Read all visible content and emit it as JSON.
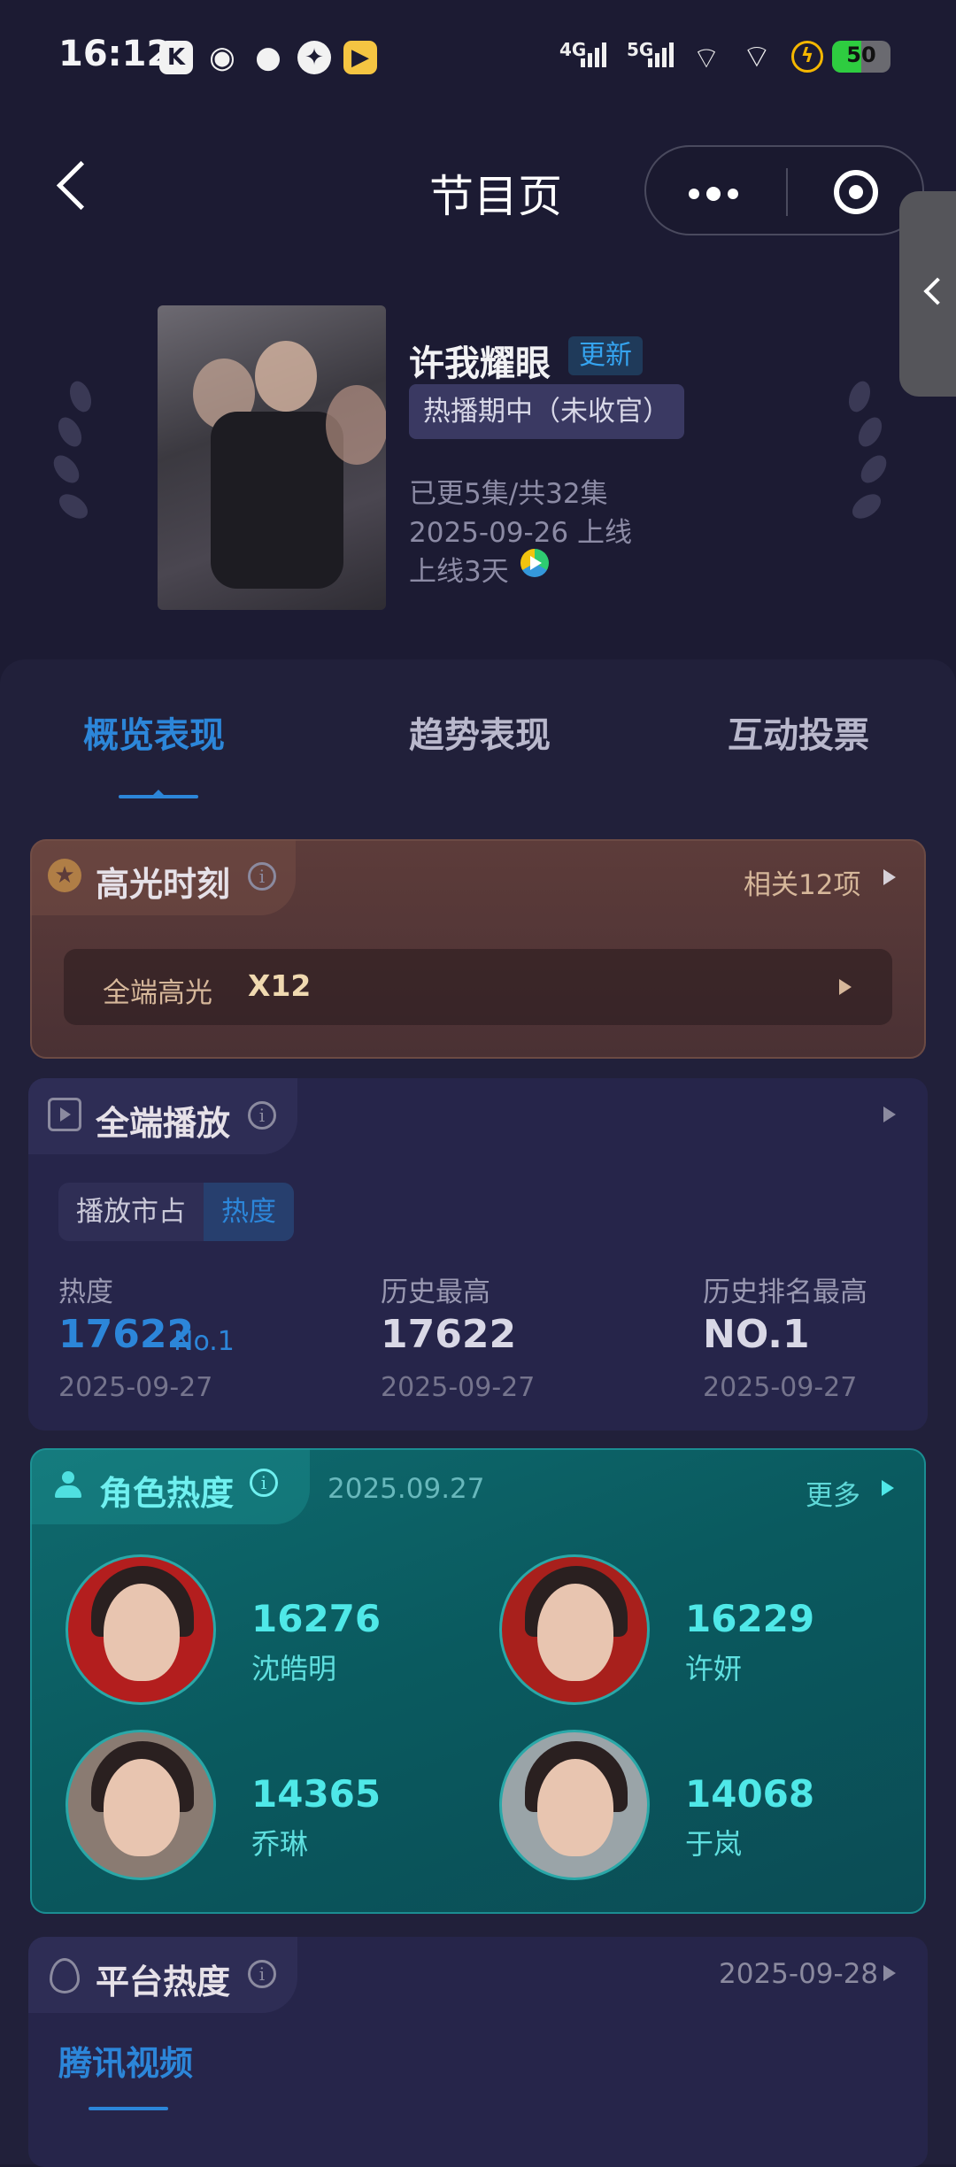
{
  "status_bar": {
    "time": "16:12",
    "app_icons": [
      "K",
      "weibo-icon",
      "wechat-icon",
      "browser-icon",
      "game-icon"
    ],
    "network": [
      "4G",
      "5G"
    ],
    "battery": "50"
  },
  "nav": {
    "title": "节目页"
  },
  "show": {
    "title": "许我耀眼",
    "update_badge": "更新",
    "status": "热播期中（未收官）",
    "episodes": "已更5集/共32集",
    "release": "2025-09-26 上线",
    "days": "上线3天"
  },
  "tabs": [
    "概览表现",
    "趋势表现",
    "互动投票"
  ],
  "highlight": {
    "title": "高光时刻",
    "related": "相关12项",
    "row_label": "全端高光",
    "row_value": "X12"
  },
  "playback": {
    "title": "全端播放",
    "segments": [
      "播放市占",
      "热度"
    ],
    "stats": [
      {
        "label": "热度",
        "value": "17622",
        "rank": "No.1",
        "date": "2025-09-27"
      },
      {
        "label": "历史最高",
        "value": "17622",
        "date": "2025-09-27"
      },
      {
        "label": "历史排名最高",
        "value": "NO.1",
        "date": "2025-09-27"
      }
    ]
  },
  "characters": {
    "title": "角色热度",
    "date": "2025.09.27",
    "more": "更多",
    "list": [
      {
        "value": "16276",
        "name": "沈皓明"
      },
      {
        "value": "16229",
        "name": "许妍"
      },
      {
        "value": "14365",
        "name": "乔琳"
      },
      {
        "value": "14068",
        "name": "于岚"
      }
    ]
  },
  "platform": {
    "title": "平台热度",
    "date": "2025-09-28",
    "tab": "腾讯视频"
  },
  "colors": {
    "background": "#1c1b33",
    "accent_blue": "#2c86d9",
    "teal": "#4fe8e8",
    "highlight_brown": "#5d3c3a"
  }
}
